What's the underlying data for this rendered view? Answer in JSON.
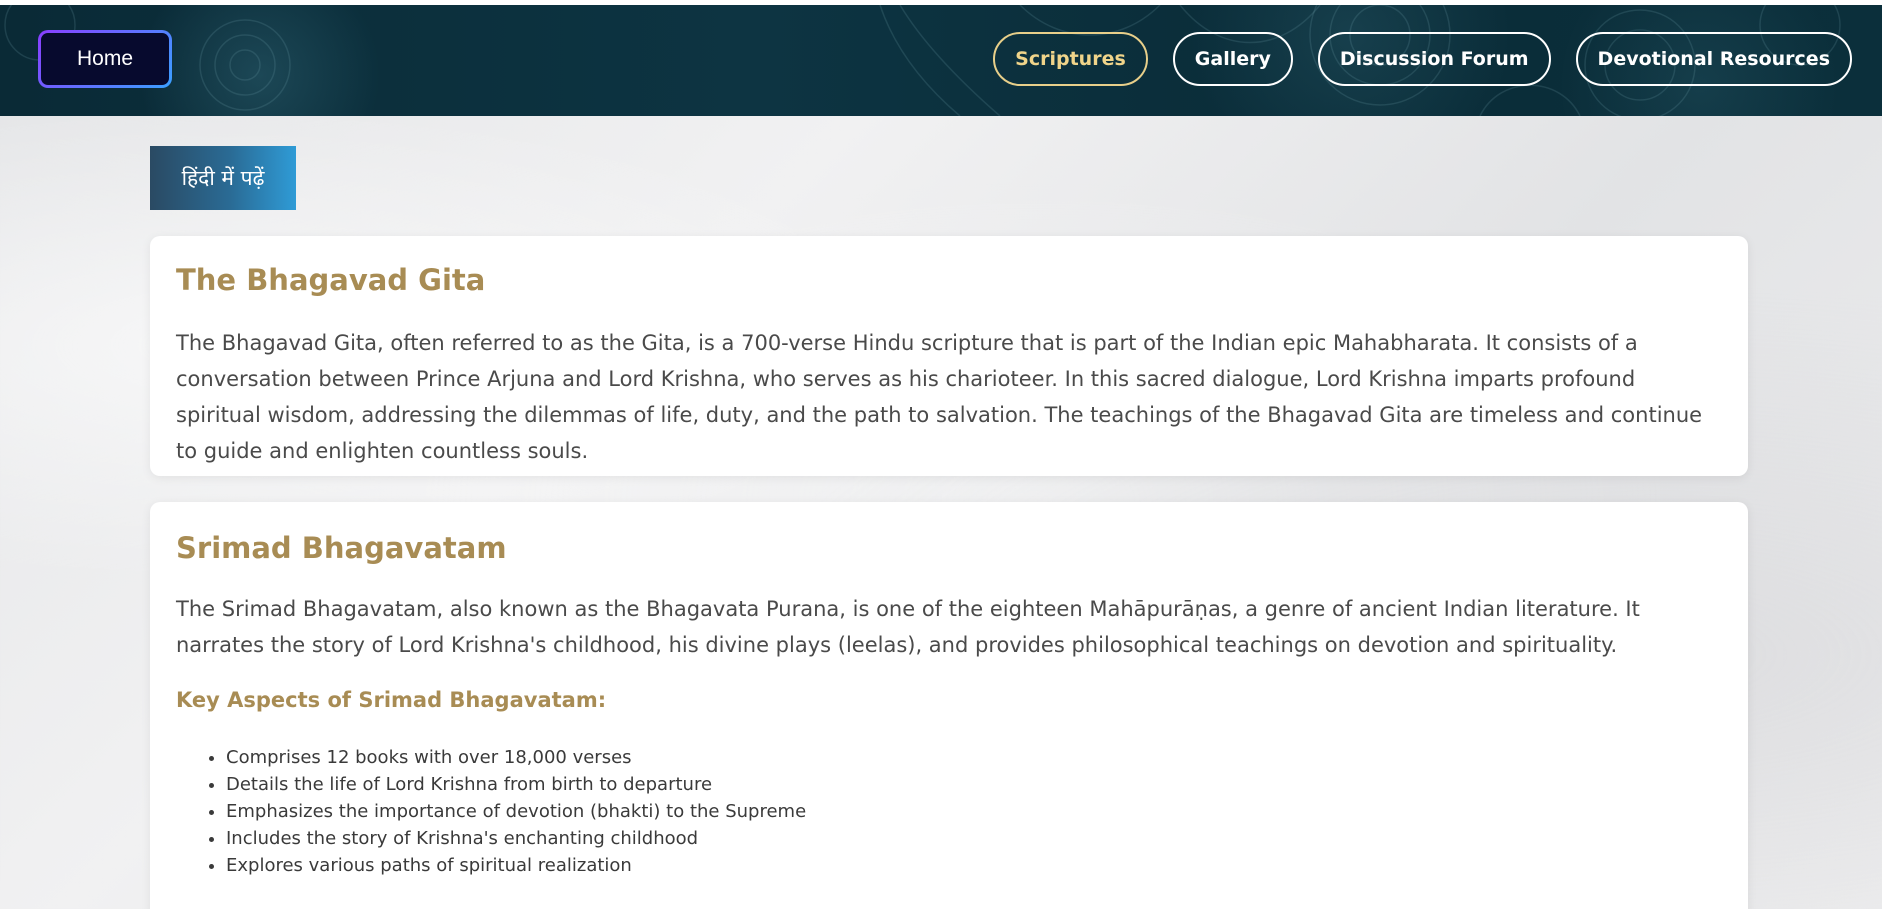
{
  "nav": {
    "home_label": "Home",
    "links": [
      {
        "label": "Scriptures",
        "active": true
      },
      {
        "label": "Gallery",
        "active": false
      },
      {
        "label": "Discussion Forum",
        "active": false
      },
      {
        "label": "Devotional Resources",
        "active": false
      }
    ]
  },
  "language_button": "हिंदी में पढ़ें",
  "sections": [
    {
      "title": "The Bhagavad Gita",
      "body": "The Bhagavad Gita, often referred to as the Gita, is a 700-verse Hindu scripture that is part of the Indian epic Mahabharata. It consists of a conversation between Prince Arjuna and Lord Krishna, who serves as his charioteer. In this sacred dialogue, Lord Krishna imparts profound spiritual wisdom, addressing the dilemmas of life, duty, and the path to salvation. The teachings of the Bhagavad Gita are timeless and continue to guide and enlighten countless souls."
    },
    {
      "title": "Srimad Bhagavatam",
      "body": "The Srimad Bhagavatam, also known as the Bhagavata Purana, is one of the eighteen Mahāpurāṇas, a genre of ancient Indian literature. It narrates the story of Lord Krishna's childhood, his divine plays (leelas), and provides philosophical teachings on devotion and spirituality.",
      "subheading": "Key Aspects of Srimad Bhagavatam:",
      "points": [
        "Comprises 12 books with over 18,000 verses",
        "Details the life of Lord Krishna from birth to departure",
        "Emphasizes the importance of devotion (bhakti) to the Supreme",
        "Includes the story of Krishna's enchanting childhood",
        "Explores various paths of spiritual realization"
      ]
    }
  ],
  "colors": {
    "nav_background": "#0d3442",
    "active_link": "#f0d48a",
    "heading": "#a88c54",
    "home_border_start": "#8a3dff",
    "home_border_end": "#3aa0ff"
  }
}
